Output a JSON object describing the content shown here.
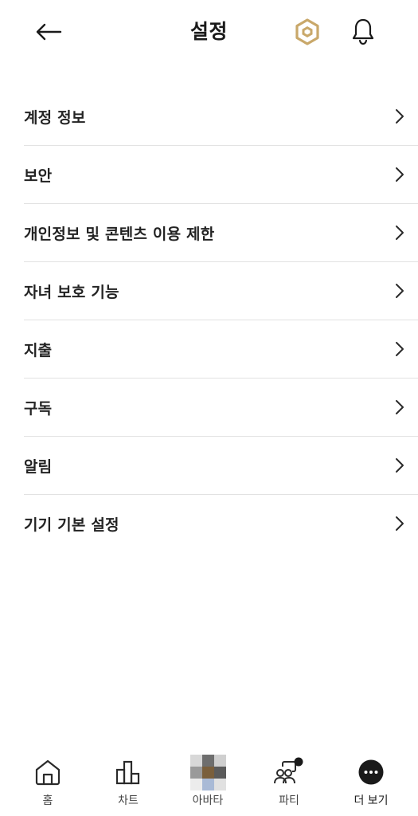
{
  "header": {
    "title": "설정"
  },
  "menu": {
    "items": [
      {
        "label": "계정 정보"
      },
      {
        "label": "보안"
      },
      {
        "label": "개인정보 및 콘텐츠 이용 제한"
      },
      {
        "label": "자녀 보호 기능"
      },
      {
        "label": "지출"
      },
      {
        "label": "구독"
      },
      {
        "label": "알림"
      },
      {
        "label": "기기 기본 설정"
      }
    ]
  },
  "bottom_nav": {
    "items": [
      {
        "label": "홈",
        "icon": "home-icon"
      },
      {
        "label": "차트",
        "icon": "chart-icon"
      },
      {
        "label": "아바타",
        "icon": "avatar-icon"
      },
      {
        "label": "파티",
        "icon": "party-icon"
      },
      {
        "label": "더 보기",
        "icon": "more-icon"
      }
    ]
  },
  "colors": {
    "robux_gold": "#c9a86a",
    "divider": "#e2e2e2",
    "text": "#232323"
  }
}
